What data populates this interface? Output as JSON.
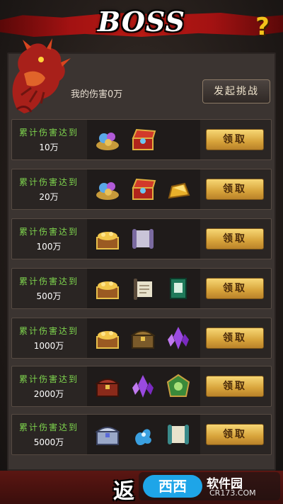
{
  "header": {
    "title": "BOSS",
    "help_label": "?"
  },
  "boss": {
    "my_damage_text": "我的伤害0万",
    "challenge_label": "发起挑战"
  },
  "rows": [
    {
      "req_label": "累计伤害达到",
      "threshold": "10万",
      "claim_label": "领取",
      "items": [
        "gem-pouch-icon",
        "treasure-chest-red-icon"
      ]
    },
    {
      "req_label": "累计伤害达到",
      "threshold": "20万",
      "claim_label": "领取",
      "items": [
        "gem-pouch-icon",
        "treasure-chest-red-icon",
        "gold-ingot-icon"
      ]
    },
    {
      "req_label": "累计伤害达到",
      "threshold": "100万",
      "claim_label": "领取",
      "items": [
        "gold-chest-icon",
        "scroll-icon"
      ]
    },
    {
      "req_label": "累计伤害达到",
      "threshold": "500万",
      "claim_label": "领取",
      "items": [
        "gold-chest-icon",
        "scroll-open-icon",
        "skill-book-icon"
      ]
    },
    {
      "req_label": "累计伤害达到",
      "threshold": "1000万",
      "claim_label": "领取",
      "items": [
        "gold-chest-icon",
        "wooden-chest-icon",
        "purple-crystal-icon"
      ]
    },
    {
      "req_label": "累计伤害达到",
      "threshold": "2000万",
      "claim_label": "领取",
      "items": [
        "red-chest-icon",
        "purple-crystal-icon",
        "green-emblem-icon"
      ]
    },
    {
      "req_label": "累计伤害达到",
      "threshold": "5000万",
      "claim_label": "领取",
      "items": [
        "silver-chest-icon",
        "blue-spirit-icon",
        "scroll-icon"
      ]
    }
  ],
  "footer": {
    "back_label": "返",
    "watermark_logo": "西西",
    "watermark_name": "软件园",
    "watermark_url": "CR173.COM"
  },
  "colors": {
    "claim_gold": "#e0ad45",
    "req_green": "#7fd64e",
    "banner_red": "#b81a14",
    "help_yellow": "#f3c21a"
  }
}
